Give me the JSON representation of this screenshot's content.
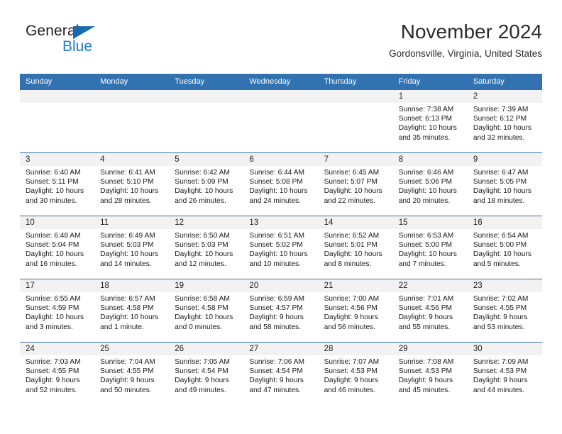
{
  "brand": {
    "name_top": "General",
    "name_bottom": "Blue",
    "triangle_color": "#1769b0",
    "text_color": "#231f20",
    "blue_text_color": "#1f7cc4"
  },
  "header": {
    "title": "November 2024",
    "subtitle": "Gordonsville, Virginia, United States"
  },
  "theme": {
    "header_blue": "#3272b0",
    "row_divider_blue": "#3272b0",
    "day_number_band": "#f2f2f2",
    "page_background": "#ffffff"
  },
  "weekdays": [
    "Sunday",
    "Monday",
    "Tuesday",
    "Wednesday",
    "Thursday",
    "Friday",
    "Saturday"
  ],
  "weeks": [
    [
      {
        "day": "",
        "info": ""
      },
      {
        "day": "",
        "info": ""
      },
      {
        "day": "",
        "info": ""
      },
      {
        "day": "",
        "info": ""
      },
      {
        "day": "",
        "info": ""
      },
      {
        "day": "1",
        "info": "Sunrise: 7:38 AM\nSunset: 6:13 PM\nDaylight: 10 hours and 35 minutes."
      },
      {
        "day": "2",
        "info": "Sunrise: 7:39 AM\nSunset: 6:12 PM\nDaylight: 10 hours and 32 minutes."
      }
    ],
    [
      {
        "day": "3",
        "info": "Sunrise: 6:40 AM\nSunset: 5:11 PM\nDaylight: 10 hours and 30 minutes."
      },
      {
        "day": "4",
        "info": "Sunrise: 6:41 AM\nSunset: 5:10 PM\nDaylight: 10 hours and 28 minutes."
      },
      {
        "day": "5",
        "info": "Sunrise: 6:42 AM\nSunset: 5:09 PM\nDaylight: 10 hours and 26 minutes."
      },
      {
        "day": "6",
        "info": "Sunrise: 6:44 AM\nSunset: 5:08 PM\nDaylight: 10 hours and 24 minutes."
      },
      {
        "day": "7",
        "info": "Sunrise: 6:45 AM\nSunset: 5:07 PM\nDaylight: 10 hours and 22 minutes."
      },
      {
        "day": "8",
        "info": "Sunrise: 6:46 AM\nSunset: 5:06 PM\nDaylight: 10 hours and 20 minutes."
      },
      {
        "day": "9",
        "info": "Sunrise: 6:47 AM\nSunset: 5:05 PM\nDaylight: 10 hours and 18 minutes."
      }
    ],
    [
      {
        "day": "10",
        "info": "Sunrise: 6:48 AM\nSunset: 5:04 PM\nDaylight: 10 hours and 16 minutes."
      },
      {
        "day": "11",
        "info": "Sunrise: 6:49 AM\nSunset: 5:03 PM\nDaylight: 10 hours and 14 minutes."
      },
      {
        "day": "12",
        "info": "Sunrise: 6:50 AM\nSunset: 5:03 PM\nDaylight: 10 hours and 12 minutes."
      },
      {
        "day": "13",
        "info": "Sunrise: 6:51 AM\nSunset: 5:02 PM\nDaylight: 10 hours and 10 minutes."
      },
      {
        "day": "14",
        "info": "Sunrise: 6:52 AM\nSunset: 5:01 PM\nDaylight: 10 hours and 8 minutes."
      },
      {
        "day": "15",
        "info": "Sunrise: 6:53 AM\nSunset: 5:00 PM\nDaylight: 10 hours and 7 minutes."
      },
      {
        "day": "16",
        "info": "Sunrise: 6:54 AM\nSunset: 5:00 PM\nDaylight: 10 hours and 5 minutes."
      }
    ],
    [
      {
        "day": "17",
        "info": "Sunrise: 6:55 AM\nSunset: 4:59 PM\nDaylight: 10 hours and 3 minutes."
      },
      {
        "day": "18",
        "info": "Sunrise: 6:57 AM\nSunset: 4:58 PM\nDaylight: 10 hours and 1 minute."
      },
      {
        "day": "19",
        "info": "Sunrise: 6:58 AM\nSunset: 4:58 PM\nDaylight: 10 hours and 0 minutes."
      },
      {
        "day": "20",
        "info": "Sunrise: 6:59 AM\nSunset: 4:57 PM\nDaylight: 9 hours and 58 minutes."
      },
      {
        "day": "21",
        "info": "Sunrise: 7:00 AM\nSunset: 4:56 PM\nDaylight: 9 hours and 56 minutes."
      },
      {
        "day": "22",
        "info": "Sunrise: 7:01 AM\nSunset: 4:56 PM\nDaylight: 9 hours and 55 minutes."
      },
      {
        "day": "23",
        "info": "Sunrise: 7:02 AM\nSunset: 4:55 PM\nDaylight: 9 hours and 53 minutes."
      }
    ],
    [
      {
        "day": "24",
        "info": "Sunrise: 7:03 AM\nSunset: 4:55 PM\nDaylight: 9 hours and 52 minutes."
      },
      {
        "day": "25",
        "info": "Sunrise: 7:04 AM\nSunset: 4:55 PM\nDaylight: 9 hours and 50 minutes."
      },
      {
        "day": "26",
        "info": "Sunrise: 7:05 AM\nSunset: 4:54 PM\nDaylight: 9 hours and 49 minutes."
      },
      {
        "day": "27",
        "info": "Sunrise: 7:06 AM\nSunset: 4:54 PM\nDaylight: 9 hours and 47 minutes."
      },
      {
        "day": "28",
        "info": "Sunrise: 7:07 AM\nSunset: 4:53 PM\nDaylight: 9 hours and 46 minutes."
      },
      {
        "day": "29",
        "info": "Sunrise: 7:08 AM\nSunset: 4:53 PM\nDaylight: 9 hours and 45 minutes."
      },
      {
        "day": "30",
        "info": "Sunrise: 7:09 AM\nSunset: 4:53 PM\nDaylight: 9 hours and 44 minutes."
      }
    ]
  ]
}
